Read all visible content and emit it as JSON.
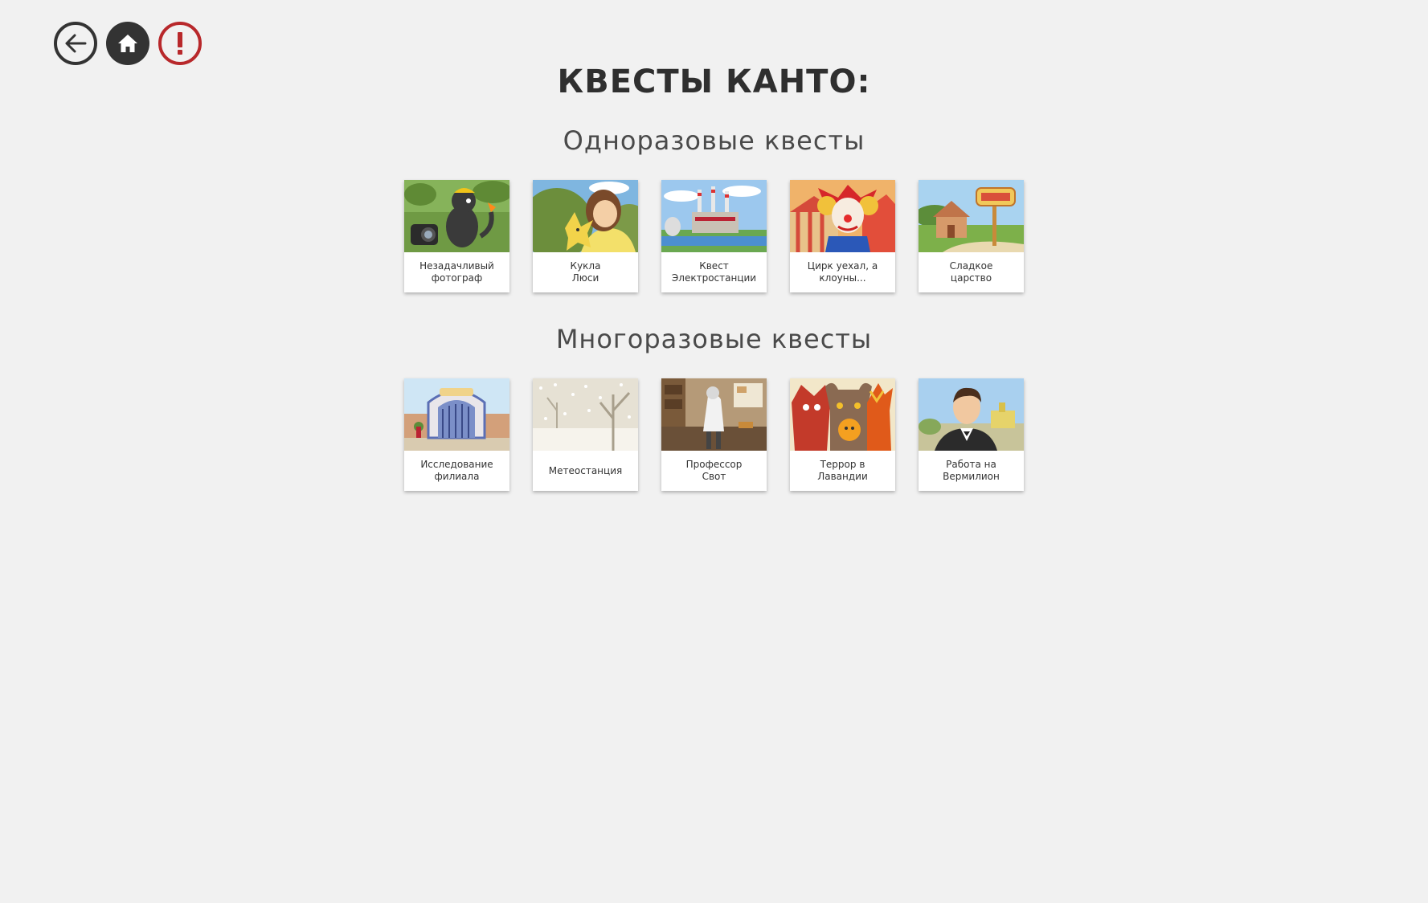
{
  "header": {
    "title": "КВЕСТЫ КАНТО:"
  },
  "nav": {
    "back_icon": "arrow-left-icon",
    "home_icon": "home-icon",
    "alert_icon": "exclamation-icon",
    "alert_color": "#b8282b"
  },
  "sections": [
    {
      "title": "Одноразовые квесты",
      "quests": [
        {
          "label": "Незадачливый\nфотограф",
          "thumbnail": "photographer"
        },
        {
          "label": "Кукла\nЛюси",
          "thumbnail": "girl-with-doll"
        },
        {
          "label": "Квест\nЭлектростанции",
          "thumbnail": "power-plant"
        },
        {
          "label": "Цирк уехал, а\nклоуны...",
          "thumbnail": "clown"
        },
        {
          "label": "Сладкое\nцарство",
          "thumbnail": "candy-kingdom"
        }
      ]
    },
    {
      "title": "Многоразовые квесты",
      "quests": [
        {
          "label": "Исследование\nфилиала",
          "thumbnail": "safari-gate"
        },
        {
          "label": "Метеостанция",
          "thumbnail": "snowy-forest"
        },
        {
          "label": "Профессор\nСвот",
          "thumbnail": "professor-lab"
        },
        {
          "label": "Террор в\nЛавандии",
          "thumbnail": "monsters"
        },
        {
          "label": "Работа на\nВермилион",
          "thumbnail": "businessman"
        }
      ]
    }
  ]
}
